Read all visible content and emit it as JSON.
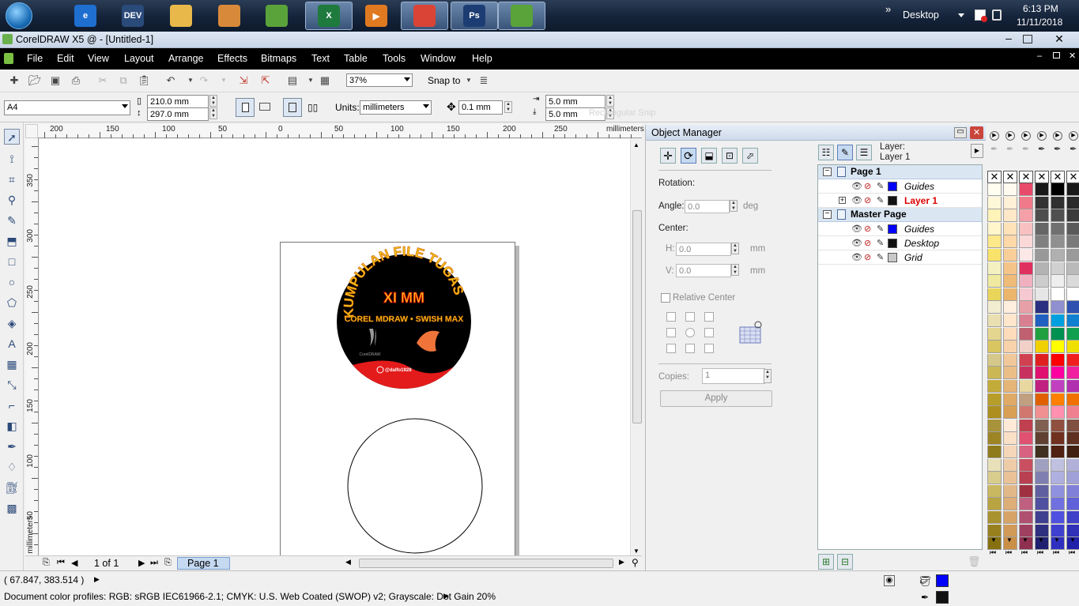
{
  "taskbar": {
    "apps": [
      {
        "name": "internet-explorer",
        "label": "e",
        "color": "#1e6fd0",
        "active": false
      },
      {
        "name": "devcpp",
        "label": "DEV",
        "color": "#2a4a7a",
        "active": false
      },
      {
        "name": "file-explorer",
        "label": "",
        "color": "#e8b94a",
        "active": false
      },
      {
        "name": "paint",
        "label": "",
        "color": "#d88a3a",
        "active": false
      },
      {
        "name": "coreldraw",
        "label": "",
        "color": "#5aa33a",
        "active": false
      },
      {
        "name": "excel",
        "label": "X",
        "color": "#1f7a3e",
        "active": true
      },
      {
        "name": "media",
        "label": "▶",
        "color": "#e07a20",
        "active": false
      },
      {
        "name": "chrome",
        "label": "",
        "color": "#d94436",
        "active": true
      },
      {
        "name": "photoshop",
        "label": "Ps",
        "color": "#1c3d73",
        "active": true
      },
      {
        "name": "coreldraw-2",
        "label": "",
        "color": "#5aa33a",
        "active": true
      }
    ],
    "desktop_label": "Desktop",
    "chevron": "»",
    "time": "6:13 PM",
    "date": "11/11/2018"
  },
  "window": {
    "title": "CorelDRAW X5 @ - [Untitled-1]"
  },
  "menu": [
    "File",
    "Edit",
    "View",
    "Layout",
    "Arrange",
    "Effects",
    "Bitmaps",
    "Text",
    "Table",
    "Tools",
    "Window",
    "Help"
  ],
  "toolbar": {
    "zoom": "37%",
    "snap_to": "Snap to"
  },
  "propbar": {
    "paper": "A4",
    "width": "210.0 mm",
    "height": "297.0 mm",
    "units_label": "Units:",
    "units": "millimeters",
    "nudge": "0.1 mm",
    "dup_x": "5.0 mm",
    "dup_y": "5.0 mm",
    "ghost_text": "Rectangular Snip"
  },
  "rulers": {
    "h_ticks": [
      "200",
      "150",
      "100",
      "50",
      "0",
      "50",
      "100",
      "150",
      "200",
      "250"
    ],
    "h_unit": "millimeters",
    "v_ticks": [
      "350",
      "300",
      "250",
      "200",
      "150",
      "100",
      "50"
    ],
    "v_unit": "millimeters"
  },
  "artwork": {
    "arc_text": "KUMPULAN FILE TUGAS",
    "headline": "XI MM",
    "subtitle": "COREL MDRAW • SWISH MAX",
    "small_logo": "CorelDRAW",
    "handle": "@dalfo1928",
    "bg": "#000000",
    "accent": "#e31b1b",
    "text_color": "#f5c21b"
  },
  "pagebar": {
    "counter": "1 of 1",
    "tab": "Page 1"
  },
  "docker": {
    "title": "Object Manager",
    "rotation": "Rotation:",
    "angle_label": "Angle:",
    "angle": "0.0",
    "angle_unit": "deg",
    "center": "Center:",
    "h_label": "H:",
    "h_value": "0.0",
    "v_label": "V:",
    "v_value": "0.0",
    "unit_mm": "mm",
    "relative_center": "Relative Center",
    "copies_label": "Copies:",
    "copies": "1",
    "apply": "Apply",
    "layer_label": "Layer:",
    "layer_name": "Layer 1"
  },
  "tree": [
    {
      "kind": "page",
      "label": "Page 1"
    },
    {
      "kind": "layer",
      "label": "Guides",
      "color": "#0000ff",
      "active": false
    },
    {
      "kind": "layer",
      "label": "Layer 1",
      "color": "#111111",
      "active": true
    },
    {
      "kind": "page",
      "label": "Master Page"
    },
    {
      "kind": "layer",
      "label": "Guides",
      "color": "#0000ff",
      "active": false
    },
    {
      "kind": "layer",
      "label": "Desktop",
      "color": "#111111",
      "active": false
    },
    {
      "kind": "layer",
      "label": "Grid",
      "color": "#c8c8c8",
      "active": false
    }
  ],
  "palettes": [
    [
      "#fffdf0",
      "#fff8d8",
      "#fff3b8",
      "#fff6cc",
      "#fde88a",
      "#f8e26a",
      "#f4f0c0",
      "#f0e9a0",
      "#e9d55a",
      "#f2ecd0",
      "#eadfb0",
      "#e4d590",
      "#d8c660",
      "#d6c88a",
      "#cbb855",
      "#c3ab3a",
      "#b79d2a",
      "#ad8f20",
      "#a8933a",
      "#9d8526",
      "#8f7b1c",
      "#e8e0b8",
      "#d9cd8e",
      "#c9b860",
      "#b8a443",
      "#a8922e",
      "#98801e",
      "#867010"
    ],
    [
      "#fffaf0",
      "#fff0d8",
      "#ffe8c8",
      "#ffe2b8",
      "#fdd8a8",
      "#f9ce98",
      "#f4c488",
      "#efbb78",
      "#ebb56e",
      "#ffeedd",
      "#ffe6cc",
      "#fddcbb",
      "#f7d2aa",
      "#f1c899",
      "#ebbe88",
      "#e5b477",
      "#dfaa66",
      "#d9a055",
      "#ffead8",
      "#fbe0c8",
      "#f5d6b8",
      "#efcca8",
      "#e9c298",
      "#e3b888",
      "#ddae78",
      "#d7a468",
      "#d19a58",
      "#cb9048"
    ],
    [
      "#e84a6a",
      "#f07a8a",
      "#f5a0a8",
      "#f8c0c0",
      "#fbd8d8",
      "#fde8e8",
      "#e03060",
      "#f1b0c0",
      "#f6c8d0",
      "#e8a0a8",
      "#d88090",
      "#c06070",
      "#f0d0c8",
      "#d04050",
      "#c83060",
      "#e8d8a0",
      "#c0a080",
      "#d07870",
      "#c04050",
      "#e05070",
      "#d86080",
      "#c85060",
      "#b84050",
      "#a03040",
      "#c06080",
      "#b05070",
      "#a04060",
      "#903050"
    ],
    [
      "#1a1a1a",
      "#333333",
      "#4d4d4d",
      "#666666",
      "#808080",
      "#999999",
      "#b3b3b3",
      "#cccccc",
      "#e6e6e6",
      "#2a3080",
      "#2060c0",
      "#20a040",
      "#f0d000",
      "#e02020",
      "#e01070",
      "#c02080",
      "#e06000",
      "#f09090",
      "#806050",
      "#604030",
      "#403020",
      "#a0a0c0",
      "#8080b0",
      "#6060a0",
      "#5050a0",
      "#404090",
      "#303080",
      "#202070"
    ],
    [
      "#000000",
      "#303030",
      "#505050",
      "#707070",
      "#909090",
      "#b0b0b0",
      "#d0d0d0",
      "#eeeeee",
      "#ffffff",
      "#9090d0",
      "#00a0e0",
      "#009050",
      "#ffff00",
      "#ff0000",
      "#ff00a0",
      "#c040c0",
      "#ff8000",
      "#ff90b0",
      "#905040",
      "#703020",
      "#502010",
      "#c0c0e0",
      "#b0b0e0",
      "#9090e0",
      "#7070e0",
      "#5050e0",
      "#4040d0",
      "#3030c0"
    ],
    [
      "#1a1a1a",
      "#2a2a2a",
      "#3a3a3a",
      "#5a5a5a",
      "#7a7a7a",
      "#9a9a9a",
      "#bababa",
      "#dadada",
      "#ffffff",
      "#3050b0",
      "#1080d0",
      "#10a050",
      "#f0e000",
      "#f02020",
      "#f020a0",
      "#b030b0",
      "#f07000",
      "#f08090",
      "#805040",
      "#603020",
      "#402010",
      "#b0b0d8",
      "#a0a0d8",
      "#8080d8",
      "#6060d8",
      "#4040c8",
      "#3030b8",
      "#2020a8"
    ]
  ],
  "status": {
    "coords": "( 67.847, 383.514 )",
    "profiles": "Document color profiles: RGB: sRGB IEC61966-2.1; CMYK: U.S. Web Coated (SWOP) v2; Grayscale: Dot Gain 20%",
    "fill_color": "#0000ff",
    "outline_color": "#111111"
  }
}
